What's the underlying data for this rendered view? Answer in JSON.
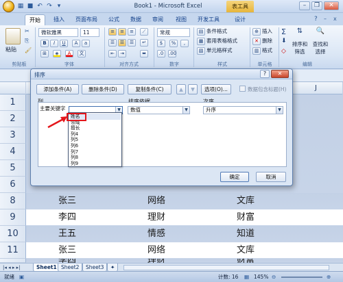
{
  "window": {
    "title": "Book1 - Microsoft Excel",
    "context_tab": "表工具"
  },
  "ribbon_tabs": [
    "开始",
    "插入",
    "页面布局",
    "公式",
    "数据",
    "审阅",
    "视图",
    "开发工具",
    "设计"
  ],
  "ribbon": {
    "clipboard": {
      "paste": "粘贴",
      "group": "剪贴板"
    },
    "font": {
      "name": "微软雅黑",
      "size": "11",
      "group": "字体"
    },
    "alignment": {
      "group": "对齐方式"
    },
    "number": {
      "format": "常规",
      "group": "数字"
    },
    "styles": {
      "items": [
        "条件格式",
        "套用表格格式",
        "单元格样式"
      ],
      "group": "样式"
    },
    "cells": {
      "items": [
        "插入",
        "删除",
        "格式"
      ],
      "group": "单元格"
    },
    "editing": {
      "sort": "排序和\n筛选",
      "find": "查找和\n选择",
      "group": "编辑"
    }
  },
  "columns": [
    "A",
    "B",
    "C",
    "D",
    "E",
    "F",
    "G",
    "H",
    "I",
    "J"
  ],
  "rows": [
    {
      "n": "1",
      "a": "",
      "b": "",
      "c": ""
    },
    {
      "n": "2",
      "a": "",
      "b": "",
      "c": ""
    },
    {
      "n": "3",
      "a": "",
      "b": "",
      "c": ""
    },
    {
      "n": "4",
      "a": "",
      "b": "",
      "c": ""
    },
    {
      "n": "5",
      "a": "",
      "b": "",
      "c": ""
    },
    {
      "n": "6",
      "a": "",
      "b": "",
      "c": ""
    },
    {
      "n": "7",
      "a": "",
      "b": "",
      "c": ""
    },
    {
      "n": "8",
      "a": "张三",
      "b": "网络",
      "c": "文库"
    },
    {
      "n": "9",
      "a": "李四",
      "b": "理财",
      "c": "财富"
    },
    {
      "n": "10",
      "a": "王五",
      "b": "情感",
      "c": "知道"
    },
    {
      "n": "11",
      "a": "张三",
      "b": "网络",
      "c": "文库"
    },
    {
      "n": "12",
      "a": "李四",
      "b": "理财",
      "c": "财富"
    }
  ],
  "sheet_tabs": [
    "Sheet1",
    "Sheet2",
    "Sheet3"
  ],
  "status": {
    "left": "就绪",
    "count": "计数: 16",
    "zoom": "145%"
  },
  "dialog": {
    "title": "排序",
    "add_level": "添加条件(A)",
    "delete_level": "删除条件(D)",
    "copy_level": "复制条件(C)",
    "options": "选项(O)...",
    "has_headers": "数据包含标题(H)",
    "col_header": "列",
    "sort_on_header": "排序依据",
    "order_header": "次序",
    "row_label": "主要关键字",
    "sort_on_value": "数值",
    "order_value": "升序",
    "ok": "确定",
    "cancel": "取消",
    "dropdown_items": [
      "姓名",
      "领域",
      "擅长",
      "列4",
      "列5",
      "列6",
      "列7",
      "列8",
      "列9"
    ]
  }
}
